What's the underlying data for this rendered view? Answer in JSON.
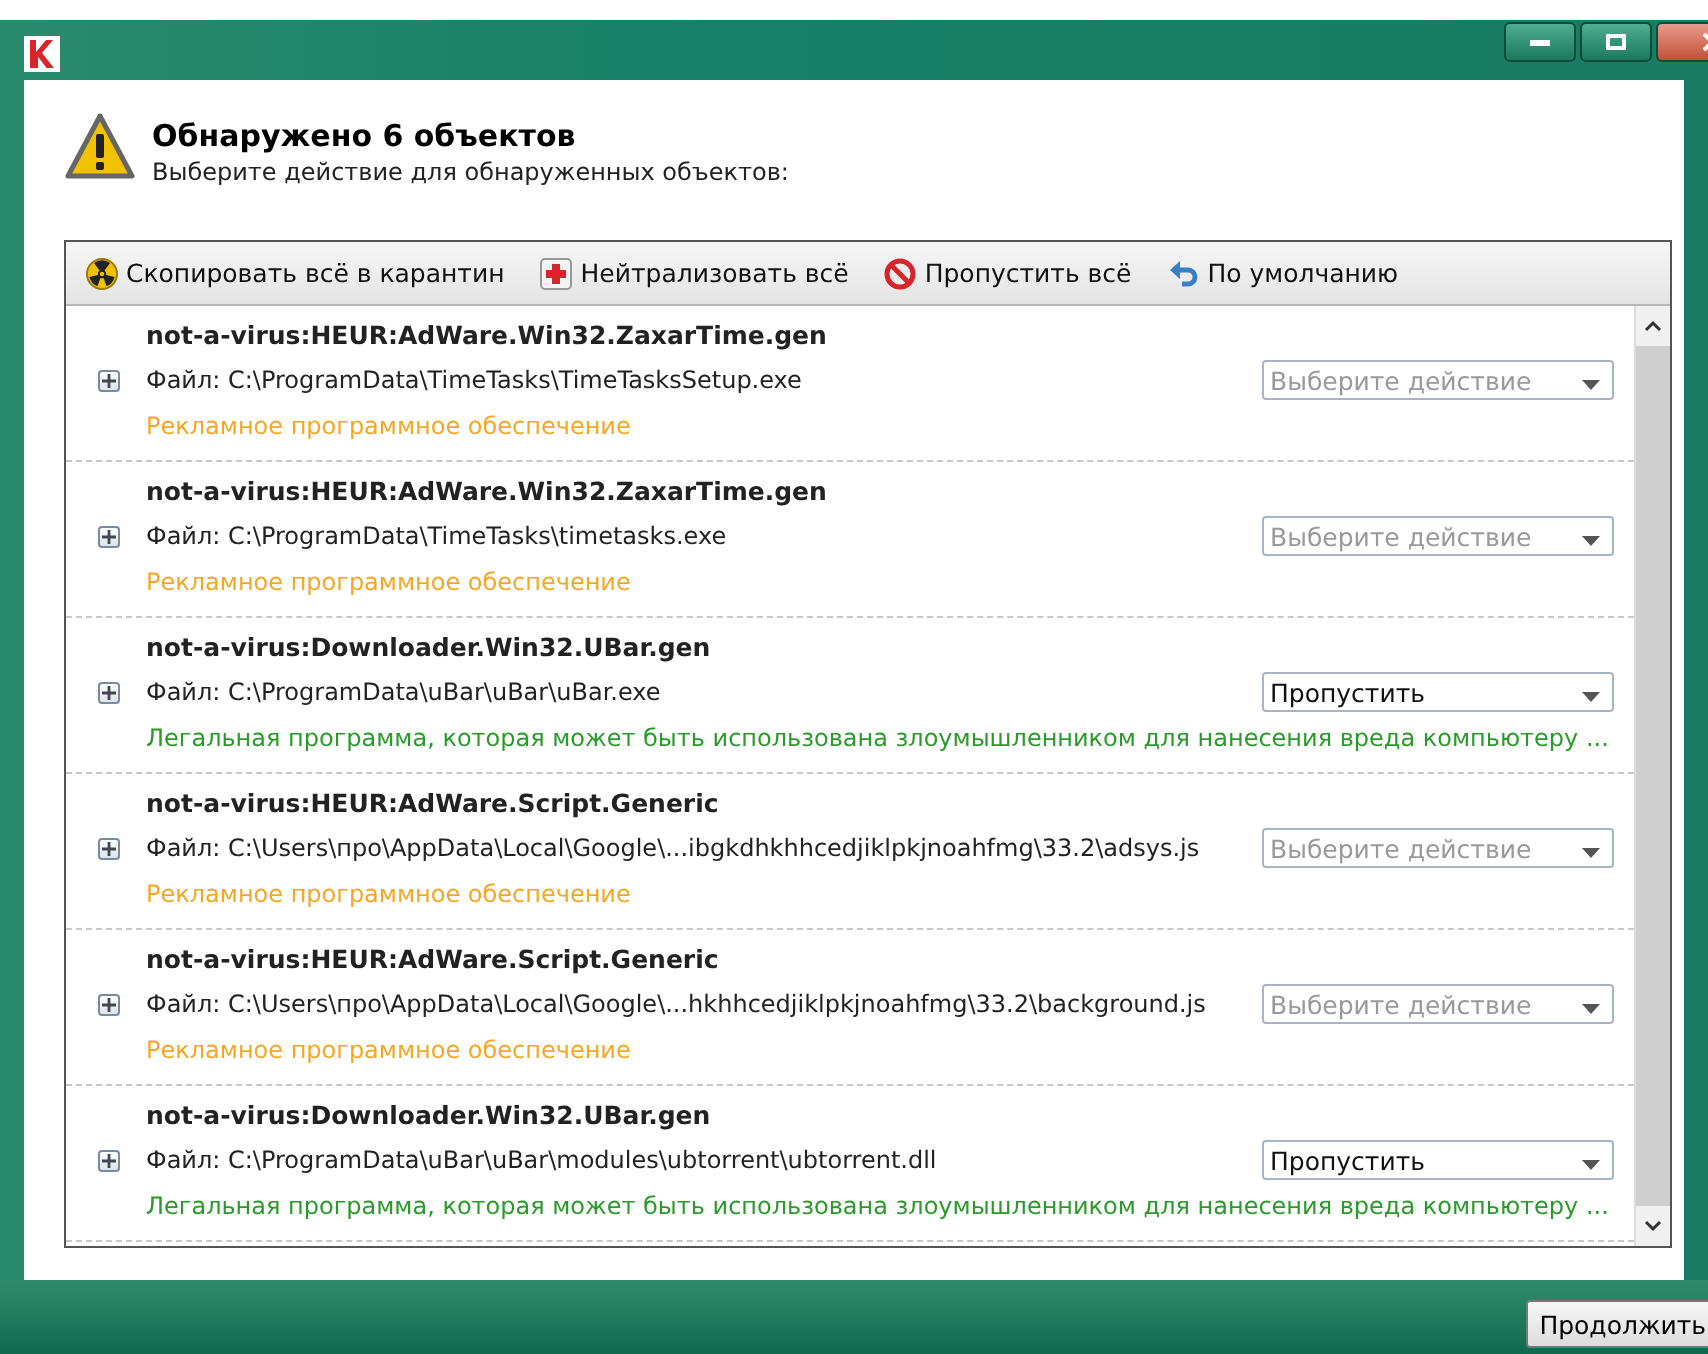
{
  "header": {
    "title": "Обнаружено 6 объектов",
    "subtitle": "Выберите действие для обнаруженных объектов:"
  },
  "toolbar": [
    {
      "kind": "quarantine",
      "label": "Скопировать всё в карантин"
    },
    {
      "kind": "disinfect",
      "label": "Нейтрализовать всё"
    },
    {
      "kind": "skip",
      "label": "Пропустить всё"
    },
    {
      "kind": "default",
      "label": "По умолчанию"
    }
  ],
  "objects": [
    {
      "name": "not-a-virus:HEUR:AdWare.Win32.ZaxarTime.gen",
      "expanded": false,
      "file": "Файл: C:\\ProgramData\\TimeTasks\\TimeTasksSetup.exe",
      "description": "Рекламное программное обеспечение",
      "color": "#f5a623",
      "action": {
        "placeholder": "Выберите действие"
      }
    },
    {
      "name": "not-a-virus:HEUR:AdWare.Win32.ZaxarTime.gen",
      "expanded": false,
      "file": "Файл: C:\\ProgramData\\TimeTasks\\timetasks.exe",
      "description": "Рекламное программное обеспечение",
      "color": "#f5a623",
      "action": {
        "placeholder": "Выберите действие"
      }
    },
    {
      "name": "not-a-virus:Downloader.Win32.UBar.gen",
      "expanded": false,
      "file": "Файл: C:\\ProgramData\\uBar\\uBar\\uBar.exe",
      "description": "Легальная программа, которая может быть использована злоумышленником для нанесения вреда компьютеру ...",
      "color": "#2a9a2a",
      "action": {
        "value": "Пропустить"
      }
    },
    {
      "name": "not-a-virus:HEUR:AdWare.Script.Generic",
      "expanded": false,
      "file": "Файл: C:\\Users\\про\\AppData\\Local\\Google\\...ibgkdhkhhcedjiklpkjnoahfmg\\33.2\\adsys.js",
      "description": "Рекламное программное обеспечение",
      "color": "#f5a623",
      "action": {
        "placeholder": "Выберите действие"
      }
    },
    {
      "name": "not-a-virus:HEUR:AdWare.Script.Generic",
      "expanded": false,
      "file": "Файл: C:\\Users\\про\\AppData\\Local\\Google\\...hkhhcedjiklpkjnoahfmg\\33.2\\background.js",
      "description": "Рекламное программное обеспечение",
      "color": "#f5a623",
      "action": {
        "placeholder": "Выберите действие"
      }
    },
    {
      "name": "not-a-virus:Downloader.Win32.UBar.gen",
      "expanded": false,
      "file": "Файл: C:\\ProgramData\\uBar\\uBar\\modules\\ubtorrent\\ubtorrent.dll",
      "description": "Легальная программа, которая может быть использована злоумышленником для нанесения вреда компьютеру ...",
      "color": "#2a9a2a",
      "action": {
        "value": "Пропустить"
      }
    }
  ],
  "footer": {
    "button": "Продолжить"
  }
}
